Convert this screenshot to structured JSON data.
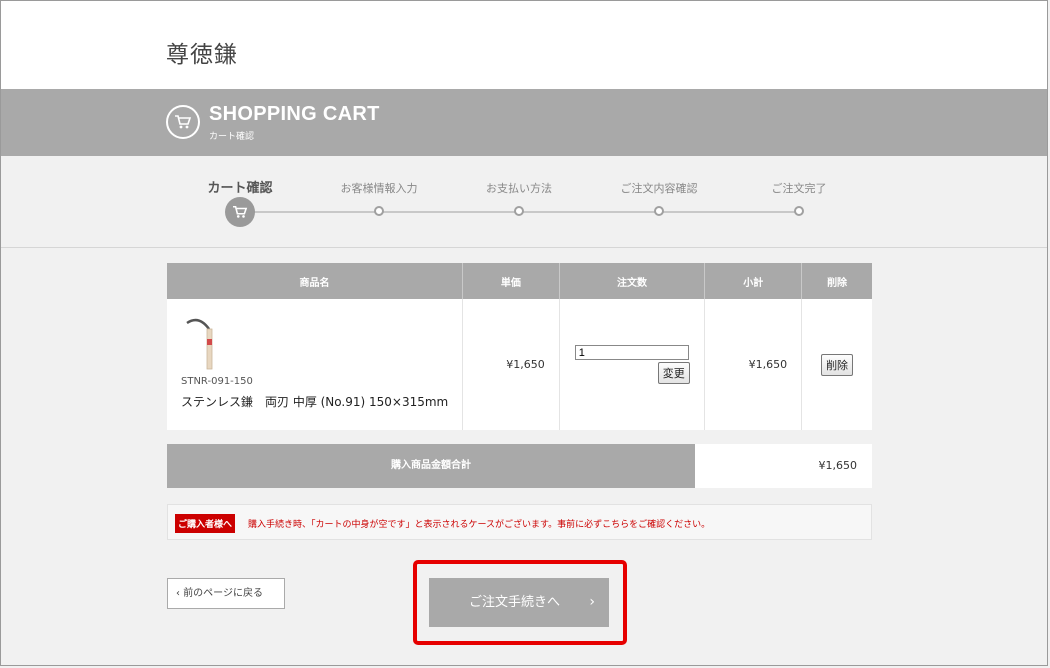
{
  "header": {
    "store_title": "尊徳鎌"
  },
  "banner": {
    "title": "SHOPPING CART",
    "subtitle": "カート確認"
  },
  "steps": [
    {
      "label": "カート確認",
      "active": true
    },
    {
      "label": "お客様情報入力",
      "active": false
    },
    {
      "label": "お支払い方法",
      "active": false
    },
    {
      "label": "ご注文内容確認",
      "active": false
    },
    {
      "label": "ご注文完了",
      "active": false
    }
  ],
  "table": {
    "headers": {
      "product": "商品名",
      "unit_price": "単価",
      "quantity": "注文数",
      "subtotal": "小計",
      "delete": "削除"
    },
    "rows": [
      {
        "code": "STNR-091-150",
        "name": "ステンレス鎌　両刃 中厚 (No.91) 150×315mm",
        "unit_price": "¥1,650",
        "quantity": "1",
        "change_label": "変更",
        "subtotal": "¥1,650",
        "delete_label": "削除"
      }
    ]
  },
  "total": {
    "label": "購入商品金額合計",
    "value": "¥1,650"
  },
  "notice": {
    "badge": "ご購入者様へ",
    "text": "購入手続き時、「カートの中身が空です」と表示されるケースがございます。事前に必ずこちらをご確認ください。"
  },
  "nav": {
    "back_label": "前のページに戻る",
    "checkout_label": "ご注文手続きへ"
  },
  "colors": {
    "accent_gray": "#a9a9a9",
    "notice_red": "#cc0000",
    "highlight_red": "#e60000"
  }
}
